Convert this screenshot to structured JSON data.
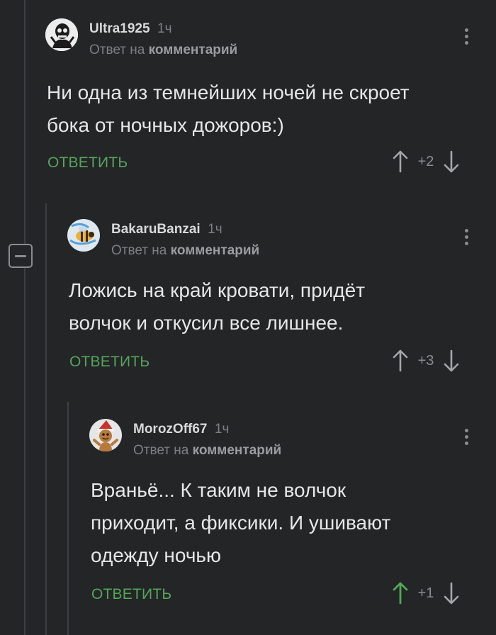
{
  "colors": {
    "background": "#232527",
    "accent_green": "#55a55a",
    "muted": "#7d8083",
    "text": "#e6e6e6"
  },
  "thread": {
    "collapse_icon": "minus-icon",
    "comments": [
      {
        "author": "Ultra1925",
        "time": "1ч",
        "reply_prefix": "Ответ на",
        "reply_target": "комментарий",
        "text": "Ни одна из темнейших ночей не скроет\nбока от ночных дожоров:)",
        "reply_label": "ОТВЕТИТЬ",
        "score": "+2",
        "upvoted": false,
        "avatar_icon": "skull-avatar-icon",
        "menu_icon": "more-vertical-icon"
      },
      {
        "author": "BakaruBanzai",
        "time": "1ч",
        "reply_prefix": "Ответ на",
        "reply_target": "комментарий",
        "text": "Ложись на край кровати, придёт\nволчок и откусил все лишнее.",
        "reply_label": "ОТВЕТИТЬ",
        "score": "+3",
        "upvoted": false,
        "avatar_icon": "bee-avatar-icon",
        "menu_icon": "more-vertical-icon"
      },
      {
        "author": "MorozOff67",
        "time": "1ч",
        "reply_prefix": "Ответ на",
        "reply_target": "комментарий",
        "text": "Враньё... К таким не волчок\nприходит, а фиксики. И ушивают\nодежду ночью",
        "reply_label": "ОТВЕТИТЬ",
        "score": "+1",
        "upvoted": true,
        "avatar_icon": "gingerbread-santa-avatar-icon",
        "menu_icon": "more-vertical-icon"
      }
    ]
  }
}
